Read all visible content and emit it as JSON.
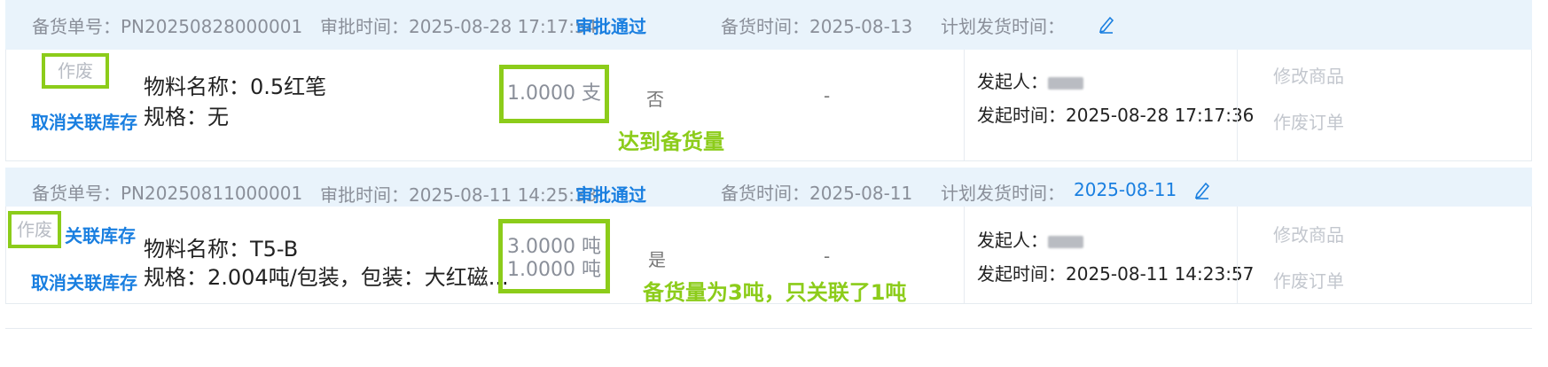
{
  "orders": [
    {
      "order_no_label": "备货单号：PN20250828000001",
      "approval_label": "审批时间：2025-08-28 17:17:54",
      "status": "审批通过",
      "stock_time_label": "备货时间：2025-08-13",
      "plan_ship_label": "计划发货时间：",
      "plan_ship_date": "",
      "void_label": "作废",
      "link_top": "",
      "link_bottom": "取消关联库存",
      "material_name": "物料名称：0.5红笔",
      "spec": "规格：无",
      "qty_line1": "1.0000 支",
      "qty_line2": "",
      "flag": "否",
      "dash": "-",
      "annotation": "达到备货量",
      "initiator_label": "发起人：",
      "initiated_time": "发起时间：2025-08-28 17:17:36",
      "action_edit": "修改商品",
      "action_void": "作废订单"
    },
    {
      "order_no_label": "备货单号：PN20250811000001",
      "approval_label": "审批时间：2025-08-11 14:25:33",
      "status": "审批通过",
      "stock_time_label": "备货时间：2025-08-11",
      "plan_ship_label": "计划发货时间：",
      "plan_ship_date": "2025-08-11",
      "void_label": "作废",
      "link_top": "关联库存",
      "link_bottom": "取消关联库存",
      "material_name": "物料名称：T5-B",
      "spec": "规格：2.004吨/包装，包装：大红磁...",
      "qty_line1": "3.0000 吨",
      "qty_line2": "1.0000 吨",
      "flag": "是",
      "dash": "-",
      "annotation": "备货量为3吨，只关联了1吨",
      "initiator_label": "发起人：",
      "initiated_time": "发起时间：2025-08-11 14:23:57",
      "action_edit": "修改商品",
      "action_void": "作废订单"
    }
  ],
  "colors": {
    "accent": "#1a7fe0",
    "highlight": "#8ccc1a",
    "header_bg": "#e9f3fb"
  },
  "icons": {
    "edit": "pencil-icon"
  }
}
